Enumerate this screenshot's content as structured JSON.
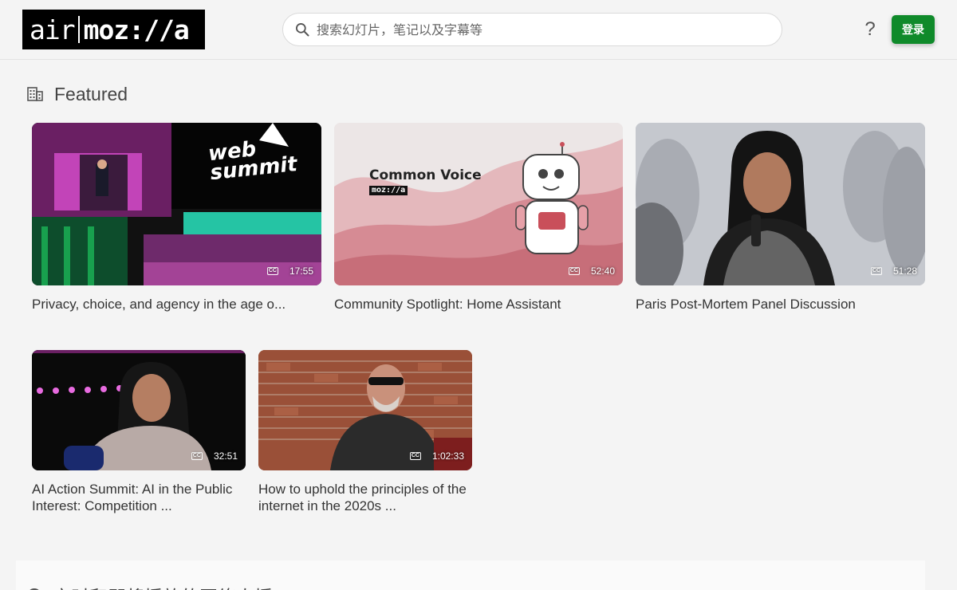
{
  "header": {
    "logo_light": "air",
    "logo_bold": "moz://a",
    "search_placeholder": "搜索幻灯片，笔记以及字幕等",
    "help_label": "?",
    "login_label": "登录"
  },
  "featured": {
    "title": "Featured",
    "videos": [
      {
        "title": "Privacy, choice, and agency in the age o...",
        "duration": "17:55",
        "cc": "CC",
        "overlay_text": "web summit"
      },
      {
        "title": "Community Spotlight: Home Assistant",
        "duration": "52:40",
        "cc": "CC",
        "overlay_title": "Common Voice",
        "overlay_brand": "moz://a"
      },
      {
        "title": "Paris Post-Mortem Panel Discussion",
        "duration": "51:28",
        "cc": "CC"
      },
      {
        "title": "AI Action Summit: AI in the Public Interest: Competition ...",
        "duration": "32:51",
        "cc": "CC"
      },
      {
        "title": "How to uphold the principles of the internet in the 2020s ...",
        "duration": "1:02:33",
        "cc": "CC"
      }
    ]
  },
  "next_section": {
    "title": "实时和即将播放的网络直播"
  }
}
